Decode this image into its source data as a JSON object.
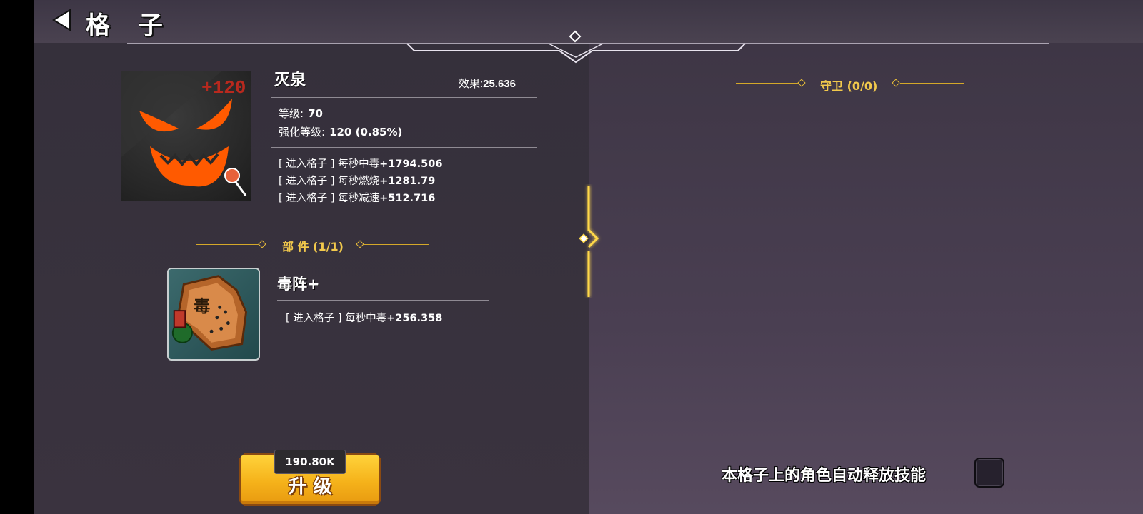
{
  "header": {
    "title": "格 子"
  },
  "item": {
    "name": "灭泉",
    "effect_label": "效果:",
    "effect_value": "25.636",
    "icon_overlay": "+120",
    "level_label": "等级:",
    "level_value": "70",
    "enhance_label": "强化等级:",
    "enhance_value": "120 (0.85%)",
    "effects": [
      {
        "prefix": "[ 进入格子 ] 每秒中毒",
        "value": "+1794.506"
      },
      {
        "prefix": "[ 进入格子 ] 每秒燃烧",
        "value": "+1281.79"
      },
      {
        "prefix": "[ 进入格子 ] 每秒减速",
        "value": "+512.716"
      }
    ]
  },
  "parts": {
    "title": "部 件",
    "count": "(1/1)",
    "items": [
      {
        "name": "毒阵+",
        "effect_prefix": "[ 进入格子 ] 每秒中毒",
        "effect_value": "+256.358"
      }
    ]
  },
  "guard": {
    "title": "守卫",
    "count": "(0/0)"
  },
  "upgrade": {
    "label": "升 级",
    "cost": "190.80K"
  },
  "auto_skill": {
    "label": "本格子上的角色自动释放技能",
    "checked": false
  },
  "colors": {
    "accent_gold": "#f2c94c",
    "button_orange": "#f5b21a",
    "icon_flame": "#ff5a00"
  },
  "icons": {
    "back": "back-arrow-icon",
    "pin": "pin-icon"
  }
}
